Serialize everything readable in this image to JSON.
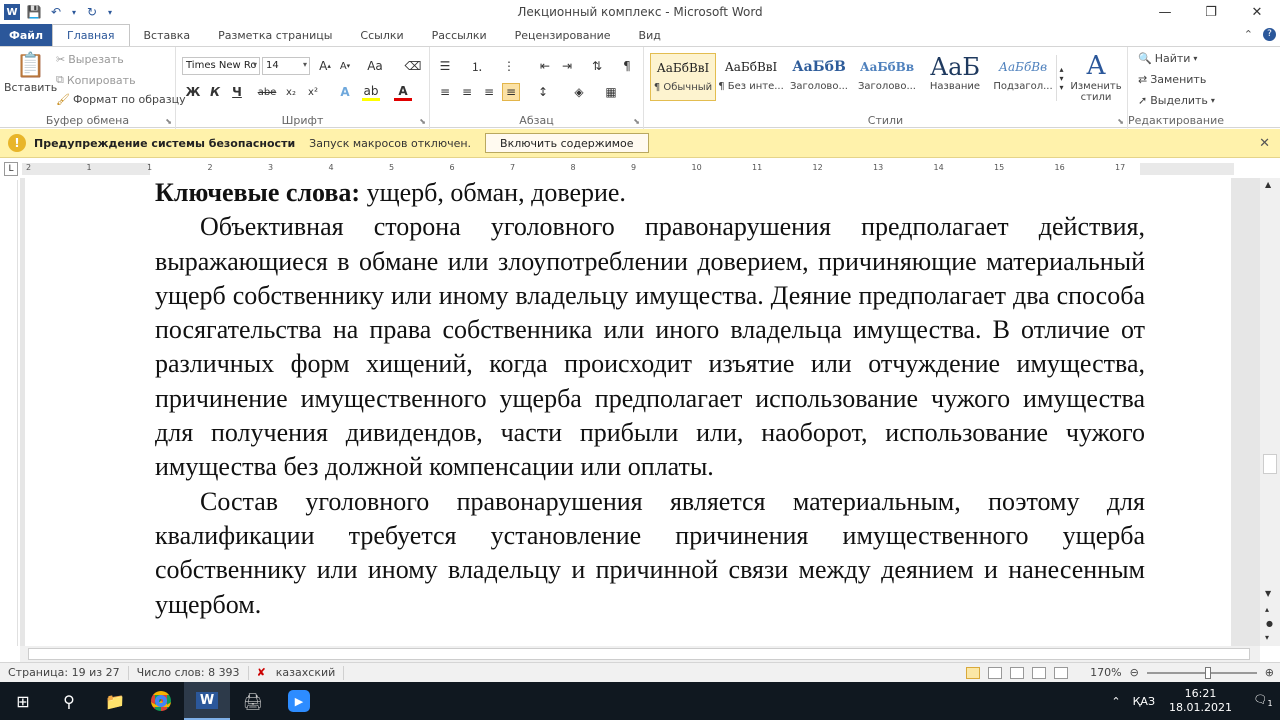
{
  "window": {
    "title": "Лекционный комплекс  -  Microsoft Word",
    "minimize": "—",
    "restore": "❐",
    "close": "✕"
  },
  "tabs": [
    {
      "label": "Файл"
    },
    {
      "label": "Главная"
    },
    {
      "label": "Вставка"
    },
    {
      "label": "Разметка страницы"
    },
    {
      "label": "Ссылки"
    },
    {
      "label": "Рассылки"
    },
    {
      "label": "Рецензирование"
    },
    {
      "label": "Вид"
    }
  ],
  "ribbon": {
    "clipboard": {
      "paste": "Вставить",
      "cut": "Вырезать",
      "copy": "Копировать",
      "format_painter": "Формат по образцу",
      "label": "Буфер обмена"
    },
    "font": {
      "font_name": "Times New Ro",
      "font_size": "14",
      "label": "Шрифт"
    },
    "paragraph": {
      "label": "Абзац"
    },
    "styles": {
      "items": [
        {
          "preview": "АаБбВвI",
          "name": "¶ Обычный"
        },
        {
          "preview": "АаБбВвI",
          "name": "¶ Без инте..."
        },
        {
          "preview": "АаБбВ",
          "name": "Заголово..."
        },
        {
          "preview": "АаБбВв",
          "name": "Заголово..."
        },
        {
          "preview": "АаБ",
          "name": "Название"
        },
        {
          "preview": "АаБбВв",
          "name": "Подзагол..."
        }
      ],
      "change_styles": "Изменить стили",
      "label": "Стили"
    },
    "editing": {
      "find": "Найти",
      "replace": "Заменить",
      "select": "Выделить",
      "label": "Редактирование"
    }
  },
  "security_bar": {
    "title": "Предупреждение системы безопасности",
    "message": "Запуск макросов отключен.",
    "button": "Включить содержимое"
  },
  "ruler": {
    "ticks": [
      "2",
      "1",
      "1",
      "2",
      "3",
      "4",
      "5",
      "6",
      "7",
      "8",
      "9",
      "10",
      "11",
      "12",
      "13",
      "14",
      "15",
      "16",
      "17"
    ]
  },
  "document": {
    "keywords_label": "Ключевые слова:",
    "keywords_text": " ущерб, обман, доверие.",
    "paragraph1": "Объективная сторона уголовного правонарушения предполагает действия, выражающиеся в обмане или злоупотреблении доверием, причиняющие материальный ущерб собственнику или иному владельцу имущества. Деяние предполагает два способа посягательства на права собственника или иного владельца имущества. В отличие от различных форм хищений, когда происходит изъятие или отчуждение имущества, причинение имущественного ущерба предполагает использование чужого имущества для получения дивидендов, части прибыли или, наоборот, использование чужого имущества без должной компенсации или оплаты.",
    "paragraph2": "Состав уголовного правонарушения является материальным, поэтому для квалификации требуется установление причинения имущественного ущерба собственнику или иному владельцу и причинной связи между деянием и нанесенным ущербом."
  },
  "status": {
    "page": "Страница: 19 из 27",
    "words": "Число слов: 8 393",
    "language": "казахский",
    "zoom": "170%"
  },
  "taskbar": {
    "language": "ҚАЗ",
    "time": "16:21",
    "date": "18.01.2021",
    "notifications": "1"
  }
}
